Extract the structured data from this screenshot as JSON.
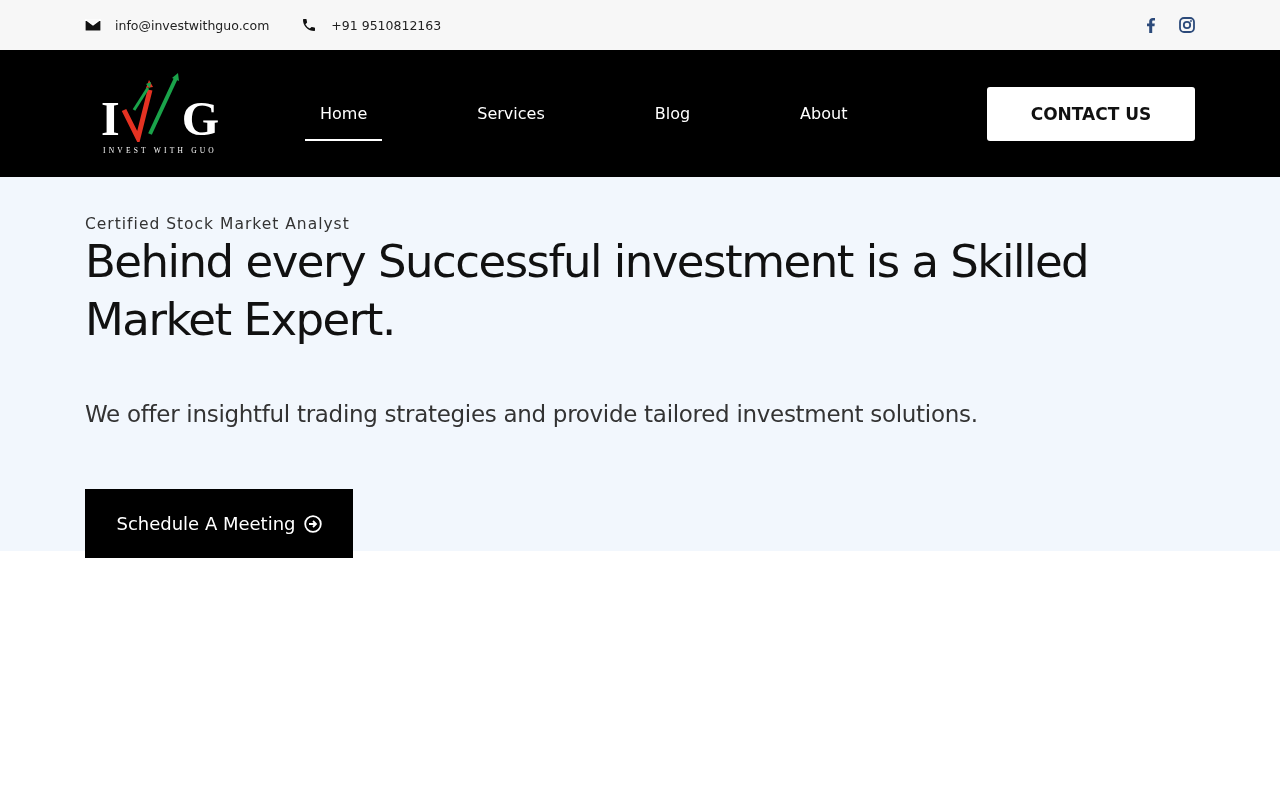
{
  "top_bar": {
    "email": "info@investwithguo.com",
    "phone": "+91 9510812163"
  },
  "logo": {
    "letter_left": "I",
    "letter_right": "G",
    "tagline": "INVEST WITH GUO"
  },
  "nav": [
    {
      "label": "Home",
      "selected": true
    },
    {
      "label": "Services",
      "selected": false
    },
    {
      "label": "Blog",
      "selected": false
    },
    {
      "label": "About",
      "selected": false
    }
  ],
  "contact_button": "CONTACT US",
  "hero": {
    "eyebrow": "Certified Stock Market Analyst",
    "heading": "Behind every Successful investment is a Skilled Market Expert.",
    "text": "We offer insightful trading strategies and provide tailored investment solutions.",
    "button": "Schedule A Meeting"
  }
}
